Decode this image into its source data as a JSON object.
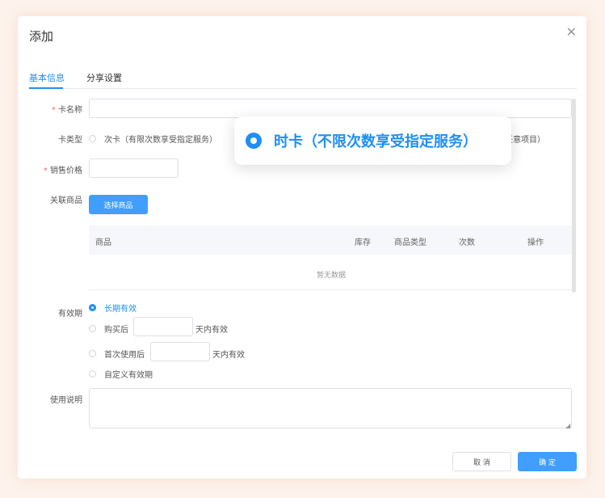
{
  "dialog": {
    "title": "添加"
  },
  "tabs": [
    {
      "label": "基本信息",
      "active": true
    },
    {
      "label": "分享设置",
      "active": false
    }
  ],
  "form": {
    "card_name": {
      "label": "卡名称",
      "required": "*",
      "value": ""
    },
    "card_type": {
      "label": "卡类型",
      "options": [
        {
          "label": "次卡（有限次数享受指定服务）",
          "checked": false
        },
        {
          "label": "时卡（不限次数享受指定服务）",
          "checked": true
        },
        {
          "label_tail": "任意项目）",
          "checked": false
        }
      ]
    },
    "price": {
      "label": "销售价格",
      "required": "*",
      "value": ""
    },
    "linked_goods": {
      "label": "关联商品",
      "select_button": "选择商品",
      "table": {
        "columns": [
          "商品",
          "库存",
          "商品类型",
          "次数",
          "操作"
        ],
        "empty_text": "暂无数据"
      }
    },
    "validity": {
      "label": "有效期",
      "options": [
        {
          "label": "长期有效",
          "checked": true
        },
        {
          "label": "购买后",
          "suffix": "天内有效",
          "checked": false
        },
        {
          "label": "首次使用后",
          "suffix": "天内有效",
          "checked": false
        },
        {
          "label": "自定义有效期",
          "checked": false
        }
      ]
    },
    "usage_note": {
      "label": "使用说明",
      "value": ""
    }
  },
  "footer": {
    "cancel": "取 消",
    "confirm": "确 定"
  },
  "colors": {
    "accent": "#1e8ff5",
    "button": "#409eff",
    "required": "#f56c6c"
  },
  "icons": {
    "close": "close-icon"
  }
}
